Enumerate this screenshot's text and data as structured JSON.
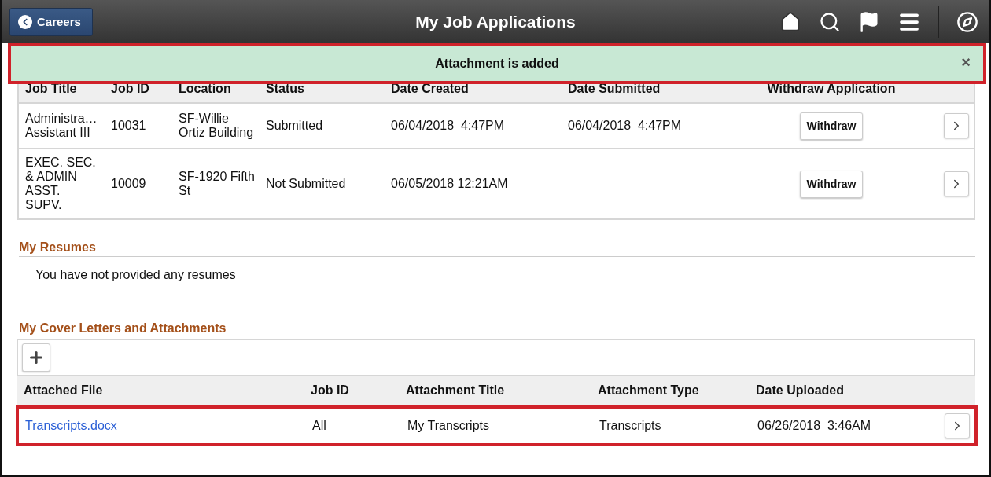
{
  "header": {
    "back_button": "Careers",
    "title": "My Job Applications"
  },
  "notification": {
    "message": "Attachment is added",
    "close": "×"
  },
  "applications": {
    "columns": [
      "Job Title",
      "Job ID",
      "Location",
      "Status",
      "Date Created",
      "Date Submitted",
      "Withdraw Application"
    ],
    "rows": [
      {
        "job_title": "Administra… Assistant III",
        "job_id": "10031",
        "location": "SF-Willie Ortiz Building",
        "status": "Submitted",
        "date_created": "06/04/2018  4:47PM",
        "date_submitted": "06/04/2018  4:47PM",
        "withdraw": "Withdraw"
      },
      {
        "job_title": "EXEC. SEC. & ADMIN ASST. SUPV.",
        "job_id": "10009",
        "location": "SF-1920 Fifth St",
        "status": "Not Submitted",
        "date_created": "06/05/2018 12:21AM",
        "date_submitted": "",
        "withdraw": "Withdraw"
      }
    ]
  },
  "resumes": {
    "heading": "My Resumes",
    "empty_text": "You have not provided any resumes"
  },
  "attachments": {
    "heading": "My Cover Letters and Attachments",
    "columns": [
      "Attached File",
      "Job ID",
      "Attachment Title",
      "Attachment Type",
      "Date Uploaded"
    ],
    "rows": [
      {
        "file": "Transcripts.docx",
        "job_id": "All",
        "title": "My Transcripts",
        "type": "Transcripts",
        "date_uploaded": "06/26/2018  3:46AM",
        "highlighted": true
      }
    ]
  }
}
